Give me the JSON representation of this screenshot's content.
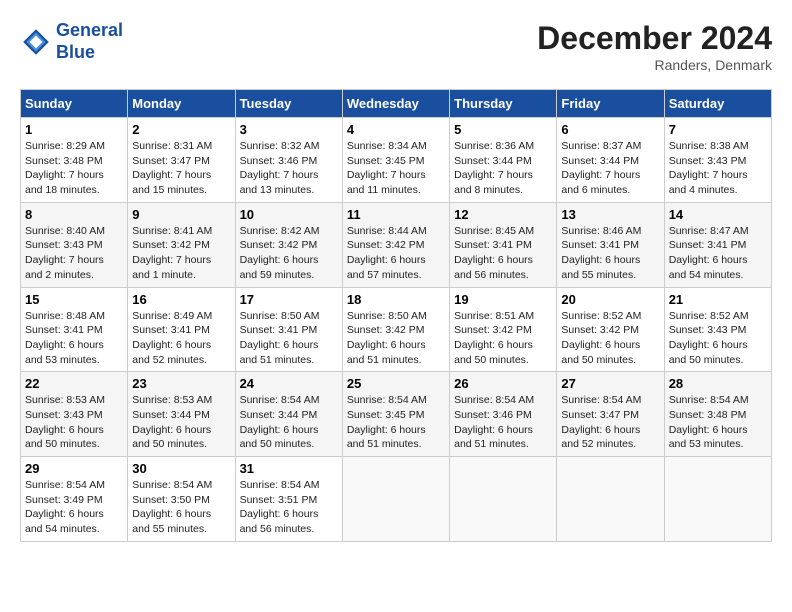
{
  "header": {
    "logo_line1": "General",
    "logo_line2": "Blue",
    "month": "December 2024",
    "location": "Randers, Denmark"
  },
  "columns": [
    "Sunday",
    "Monday",
    "Tuesday",
    "Wednesday",
    "Thursday",
    "Friday",
    "Saturday"
  ],
  "weeks": [
    [
      {
        "day": "1",
        "rise": "Sunrise: 8:29 AM",
        "set": "Sunset: 3:48 PM",
        "daylight": "Daylight: 7 hours and 18 minutes."
      },
      {
        "day": "2",
        "rise": "Sunrise: 8:31 AM",
        "set": "Sunset: 3:47 PM",
        "daylight": "Daylight: 7 hours and 15 minutes."
      },
      {
        "day": "3",
        "rise": "Sunrise: 8:32 AM",
        "set": "Sunset: 3:46 PM",
        "daylight": "Daylight: 7 hours and 13 minutes."
      },
      {
        "day": "4",
        "rise": "Sunrise: 8:34 AM",
        "set": "Sunset: 3:45 PM",
        "daylight": "Daylight: 7 hours and 11 minutes."
      },
      {
        "day": "5",
        "rise": "Sunrise: 8:36 AM",
        "set": "Sunset: 3:44 PM",
        "daylight": "Daylight: 7 hours and 8 minutes."
      },
      {
        "day": "6",
        "rise": "Sunrise: 8:37 AM",
        "set": "Sunset: 3:44 PM",
        "daylight": "Daylight: 7 hours and 6 minutes."
      },
      {
        "day": "7",
        "rise": "Sunrise: 8:38 AM",
        "set": "Sunset: 3:43 PM",
        "daylight": "Daylight: 7 hours and 4 minutes."
      }
    ],
    [
      {
        "day": "8",
        "rise": "Sunrise: 8:40 AM",
        "set": "Sunset: 3:43 PM",
        "daylight": "Daylight: 7 hours and 2 minutes."
      },
      {
        "day": "9",
        "rise": "Sunrise: 8:41 AM",
        "set": "Sunset: 3:42 PM",
        "daylight": "Daylight: 7 hours and 1 minute."
      },
      {
        "day": "10",
        "rise": "Sunrise: 8:42 AM",
        "set": "Sunset: 3:42 PM",
        "daylight": "Daylight: 6 hours and 59 minutes."
      },
      {
        "day": "11",
        "rise": "Sunrise: 8:44 AM",
        "set": "Sunset: 3:42 PM",
        "daylight": "Daylight: 6 hours and 57 minutes."
      },
      {
        "day": "12",
        "rise": "Sunrise: 8:45 AM",
        "set": "Sunset: 3:41 PM",
        "daylight": "Daylight: 6 hours and 56 minutes."
      },
      {
        "day": "13",
        "rise": "Sunrise: 8:46 AM",
        "set": "Sunset: 3:41 PM",
        "daylight": "Daylight: 6 hours and 55 minutes."
      },
      {
        "day": "14",
        "rise": "Sunrise: 8:47 AM",
        "set": "Sunset: 3:41 PM",
        "daylight": "Daylight: 6 hours and 54 minutes."
      }
    ],
    [
      {
        "day": "15",
        "rise": "Sunrise: 8:48 AM",
        "set": "Sunset: 3:41 PM",
        "daylight": "Daylight: 6 hours and 53 minutes."
      },
      {
        "day": "16",
        "rise": "Sunrise: 8:49 AM",
        "set": "Sunset: 3:41 PM",
        "daylight": "Daylight: 6 hours and 52 minutes."
      },
      {
        "day": "17",
        "rise": "Sunrise: 8:50 AM",
        "set": "Sunset: 3:41 PM",
        "daylight": "Daylight: 6 hours and 51 minutes."
      },
      {
        "day": "18",
        "rise": "Sunrise: 8:50 AM",
        "set": "Sunset: 3:42 PM",
        "daylight": "Daylight: 6 hours and 51 minutes."
      },
      {
        "day": "19",
        "rise": "Sunrise: 8:51 AM",
        "set": "Sunset: 3:42 PM",
        "daylight": "Daylight: 6 hours and 50 minutes."
      },
      {
        "day": "20",
        "rise": "Sunrise: 8:52 AM",
        "set": "Sunset: 3:42 PM",
        "daylight": "Daylight: 6 hours and 50 minutes."
      },
      {
        "day": "21",
        "rise": "Sunrise: 8:52 AM",
        "set": "Sunset: 3:43 PM",
        "daylight": "Daylight: 6 hours and 50 minutes."
      }
    ],
    [
      {
        "day": "22",
        "rise": "Sunrise: 8:53 AM",
        "set": "Sunset: 3:43 PM",
        "daylight": "Daylight: 6 hours and 50 minutes."
      },
      {
        "day": "23",
        "rise": "Sunrise: 8:53 AM",
        "set": "Sunset: 3:44 PM",
        "daylight": "Daylight: 6 hours and 50 minutes."
      },
      {
        "day": "24",
        "rise": "Sunrise: 8:54 AM",
        "set": "Sunset: 3:44 PM",
        "daylight": "Daylight: 6 hours and 50 minutes."
      },
      {
        "day": "25",
        "rise": "Sunrise: 8:54 AM",
        "set": "Sunset: 3:45 PM",
        "daylight": "Daylight: 6 hours and 51 minutes."
      },
      {
        "day": "26",
        "rise": "Sunrise: 8:54 AM",
        "set": "Sunset: 3:46 PM",
        "daylight": "Daylight: 6 hours and 51 minutes."
      },
      {
        "day": "27",
        "rise": "Sunrise: 8:54 AM",
        "set": "Sunset: 3:47 PM",
        "daylight": "Daylight: 6 hours and 52 minutes."
      },
      {
        "day": "28",
        "rise": "Sunrise: 8:54 AM",
        "set": "Sunset: 3:48 PM",
        "daylight": "Daylight: 6 hours and 53 minutes."
      }
    ],
    [
      {
        "day": "29",
        "rise": "Sunrise: 8:54 AM",
        "set": "Sunset: 3:49 PM",
        "daylight": "Daylight: 6 hours and 54 minutes."
      },
      {
        "day": "30",
        "rise": "Sunrise: 8:54 AM",
        "set": "Sunset: 3:50 PM",
        "daylight": "Daylight: 6 hours and 55 minutes."
      },
      {
        "day": "31",
        "rise": "Sunrise: 8:54 AM",
        "set": "Sunset: 3:51 PM",
        "daylight": "Daylight: 6 hours and 56 minutes."
      },
      null,
      null,
      null,
      null
    ]
  ]
}
